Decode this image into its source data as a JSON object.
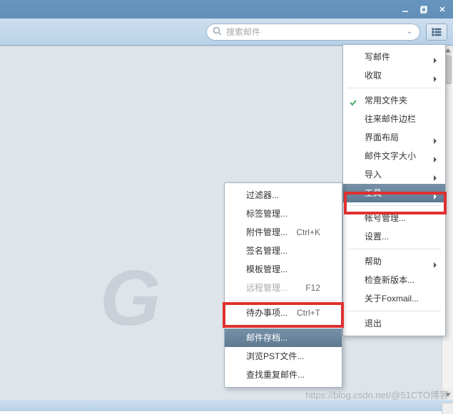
{
  "window": {
    "search_placeholder": "搜索邮件"
  },
  "menu_main": {
    "items": [
      {
        "label": "写邮件",
        "submenu": true
      },
      {
        "label": "收取",
        "submenu": true
      },
      {
        "sep": true
      },
      {
        "label": "常用文件夹",
        "checked": true
      },
      {
        "label": "往来邮件边栏"
      },
      {
        "label": "界面布局",
        "submenu": true
      },
      {
        "label": "邮件文字大小",
        "submenu": true
      },
      {
        "label": "导入",
        "submenu": true
      },
      {
        "label": "工具",
        "submenu": true,
        "highlight": true
      },
      {
        "sep": true
      },
      {
        "label": "帐号管理..."
      },
      {
        "label": "设置..."
      },
      {
        "sep": true
      },
      {
        "label": "帮助",
        "submenu": true
      },
      {
        "label": "检查新版本..."
      },
      {
        "label": "关于Foxmail..."
      },
      {
        "sep": true
      },
      {
        "label": "退出"
      }
    ]
  },
  "menu_sub": {
    "items": [
      {
        "label": "过滤器..."
      },
      {
        "label": "标签管理..."
      },
      {
        "label": "附件管理...",
        "shortcut": "Ctrl+K"
      },
      {
        "label": "签名管理..."
      },
      {
        "label": "模板管理..."
      },
      {
        "label": "远程管理...",
        "shortcut": "F12",
        "disabled": true
      },
      {
        "sep": true
      },
      {
        "label": "待办事项...",
        "shortcut": "Ctrl+T"
      },
      {
        "sep": true
      },
      {
        "label": "邮件存档...",
        "highlight": true
      },
      {
        "label": "浏览PST文件..."
      },
      {
        "label": "查找重复邮件..."
      }
    ]
  },
  "watermark": "https://blog.csdn.net/@51CTO博客"
}
